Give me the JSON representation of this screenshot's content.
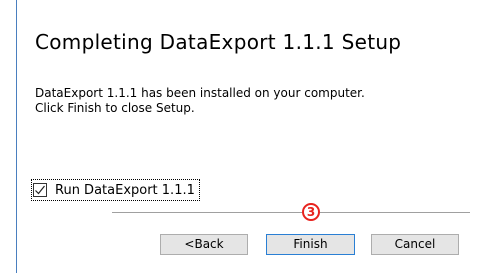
{
  "wizard": {
    "title": "Completing DataExport 1.1.1 Setup",
    "description": [
      "DataExport 1.1.1 has been installed on your computer.",
      "Click Finish to close Setup."
    ],
    "run_checkbox": {
      "label": "Run DataExport 1.1.1",
      "checked": true
    }
  },
  "annotation": {
    "step": "3",
    "color": "#e8231e"
  },
  "buttons": {
    "back": "<Back",
    "finish": "Finish",
    "cancel": "Cancel"
  },
  "colors": {
    "accent": "#2a7fd4",
    "edge": "#4a7fbf"
  }
}
